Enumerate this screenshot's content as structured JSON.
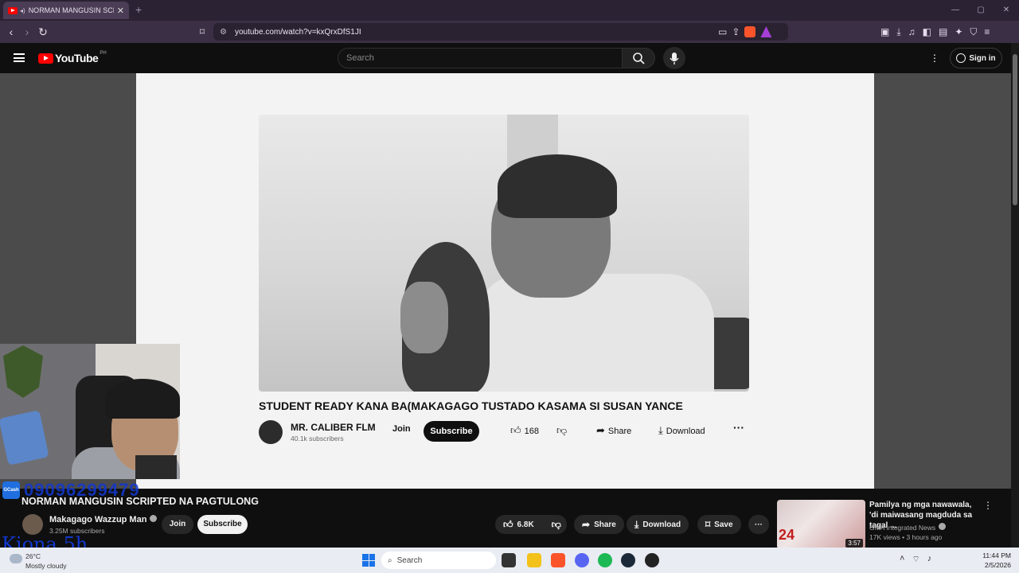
{
  "browser": {
    "tab_title": "NORMAN MANGUSIN SCRIP",
    "new_tab": "+",
    "url": "youtube.com/watch?v=kxQrxDfS1JI",
    "window_controls": [
      "—",
      "▢",
      "✕"
    ],
    "brave_shield_count": "1"
  },
  "youtube": {
    "logo_text": "YouTube",
    "country_code": "PH",
    "search_placeholder": "Search",
    "sign_in": "Sign in"
  },
  "player_content": {
    "title": "STUDENT READY KANA BA(MAKAGAGO TUSTADO KASAMA SI SUSAN YANCE",
    "channel": "MR. CALIBER FLM",
    "subscribers": "40.1k subscribers",
    "join": "Join",
    "subscribe": "Subscribe",
    "likes": "168",
    "share": "Share",
    "download": "Download"
  },
  "stream_overlay": {
    "gcash_label": "GCash",
    "phone": "09096299479",
    "name": "Kiona 5h"
  },
  "video": {
    "title": "NORMAN MANGUSIN SCRIPTED NA PAGTULONG",
    "channel": "Makagago Wazzup Man",
    "subscribers": "3.25M subscribers",
    "join": "Join",
    "subscribe": "Subscribe",
    "likes": "6.8K",
    "share": "Share",
    "download": "Download",
    "save": "Save"
  },
  "recommended": {
    "title": "Pamilya ng mga nawawala, 'di maiwasang magduda sa tagal ...",
    "channel": "GMA Integrated News",
    "meta": "17K views • 3 hours ago",
    "duration": "3:57",
    "thumb_badge": "24"
  },
  "taskbar": {
    "temperature": "26°C",
    "condition": "Mostly cloudy",
    "search": "Search",
    "time": "11:44 PM",
    "date": "2/5/2026"
  },
  "colors": {
    "youtube_red": "#ff0000",
    "overlay_blue": "#1238d0",
    "browser_purple": "#3a2f44"
  }
}
